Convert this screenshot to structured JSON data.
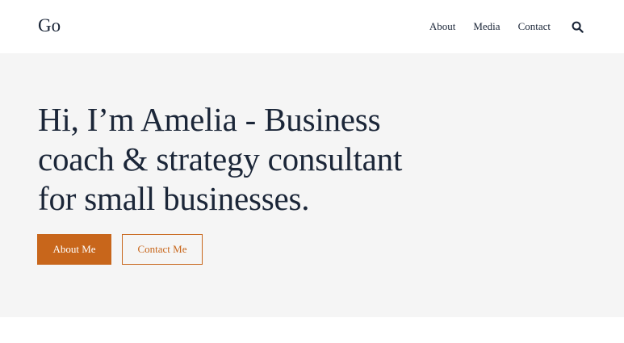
{
  "header": {
    "logo": "Go",
    "nav": [
      {
        "label": "About"
      },
      {
        "label": "Media"
      },
      {
        "label": "Contact"
      }
    ],
    "search_icon": "search-icon"
  },
  "hero": {
    "headline": "Hi, I’m Amelia - Business coach & strategy consultant for small businesses.",
    "primary_button": "About Me",
    "secondary_button": "Contact Me"
  },
  "colors": {
    "accent": "#c8661b",
    "text": "#1b2638",
    "hero_bg": "#f5f5f5",
    "page_bg": "#ffffff"
  }
}
